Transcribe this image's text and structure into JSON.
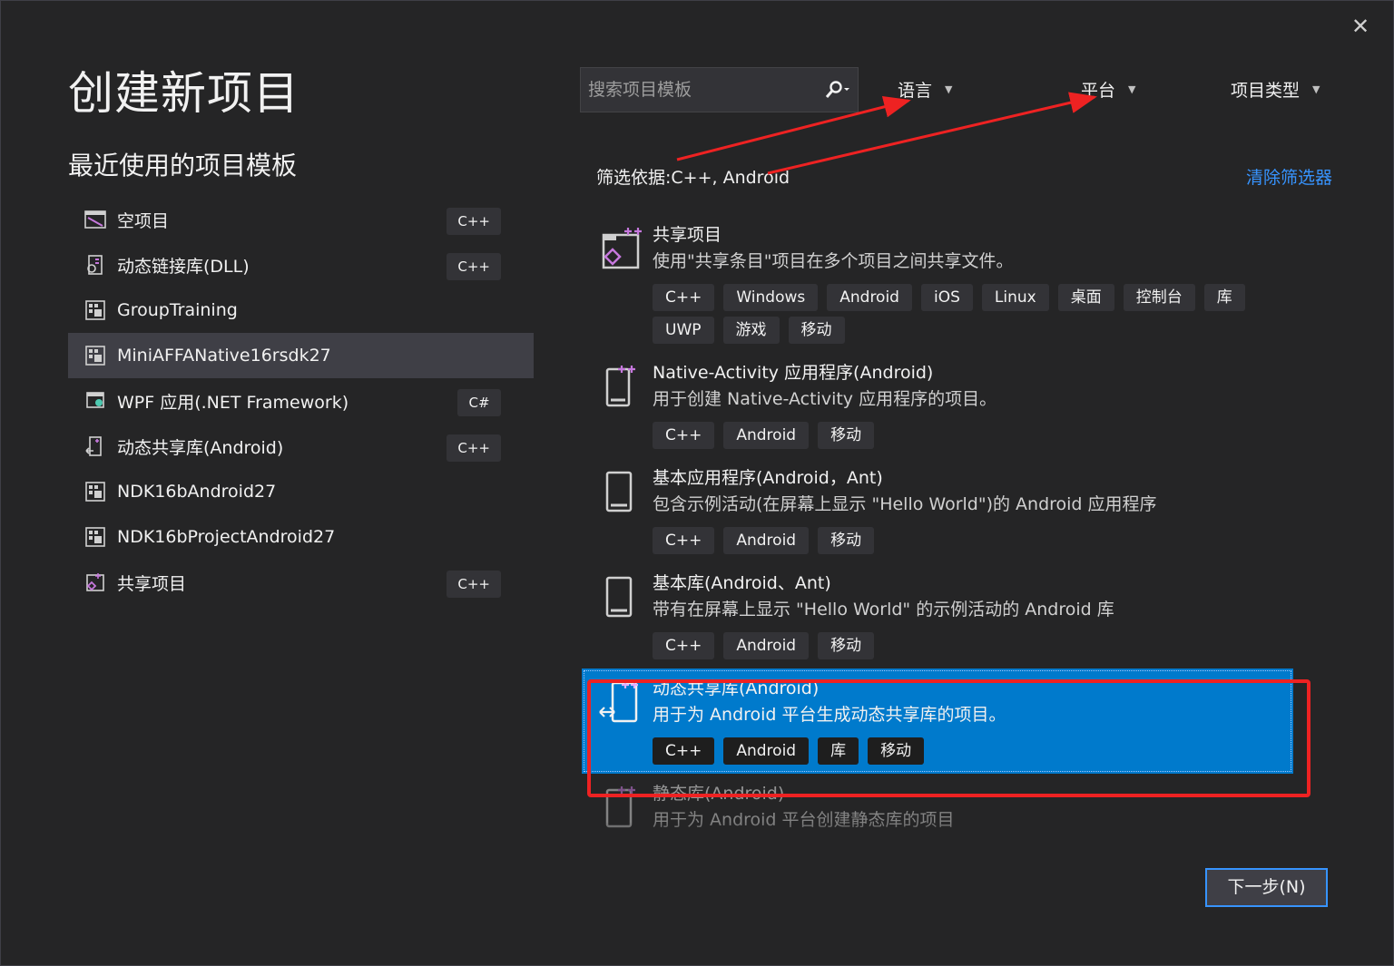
{
  "dialog": {
    "title": "创建新项目",
    "close_icon": "close-icon"
  },
  "recent": {
    "heading": "最近使用的项目模板",
    "items": [
      {
        "name": "空项目",
        "lang": "C++",
        "icon": "empty-project-icon"
      },
      {
        "name": "动态链接库(DLL)",
        "lang": "C++",
        "icon": "dll-icon"
      },
      {
        "name": "GroupTraining",
        "lang": "",
        "icon": "custom-template-icon"
      },
      {
        "name": "MiniAFFANative16rsdk27",
        "lang": "",
        "icon": "custom-template-icon",
        "selected": true
      },
      {
        "name": "WPF 应用(.NET Framework)",
        "lang": "C#",
        "icon": "wpf-icon"
      },
      {
        "name": "动态共享库(Android)",
        "lang": "C++",
        "icon": "android-lib-icon"
      },
      {
        "name": "NDK16bAndroid27",
        "lang": "",
        "icon": "custom-template-icon"
      },
      {
        "name": "NDK16bProjectAndroid27",
        "lang": "",
        "icon": "custom-template-icon"
      },
      {
        "name": "共享项目",
        "lang": "C++",
        "icon": "shared-project-icon"
      }
    ]
  },
  "search": {
    "placeholder": "搜索项目模板",
    "icon": "search-icon"
  },
  "filters": {
    "language": "语言",
    "platform": "平台",
    "project_type": "项目类型",
    "filter_by": "筛选依据:C++, Android",
    "clear": "清除筛选器"
  },
  "templates": [
    {
      "name": "共享项目",
      "desc": "使用\"共享条目\"项目在多个项目之间共享文件。",
      "icon": "shared-project-icon",
      "tags": [
        "C++",
        "Windows",
        "Android",
        "iOS",
        "Linux",
        "桌面",
        "控制台",
        "库",
        "UWP",
        "游戏",
        "移动"
      ]
    },
    {
      "name": "Native-Activity 应用程序(Android)",
      "desc": "用于创建 Native-Activity 应用程序的项目。",
      "icon": "native-activity-icon",
      "tags": [
        "C++",
        "Android",
        "移动"
      ]
    },
    {
      "name": "基本应用程序(Android，Ant)",
      "desc": "包含示例活动(在屏幕上显示 \"Hello World\")的 Android 应用程序",
      "icon": "phone-icon",
      "tags": [
        "C++",
        "Android",
        "移动"
      ]
    },
    {
      "name": "基本库(Android、Ant)",
      "desc": "带有在屏幕上显示 \"Hello World\" 的示例活动的 Android 库",
      "icon": "phone-icon",
      "tags": [
        "C++",
        "Android",
        "移动"
      ]
    },
    {
      "name": "动态共享库(Android)",
      "desc": "用于为 Android 平台生成动态共享库的项目。",
      "icon": "android-lib-icon",
      "tags": [
        "C++",
        "Android",
        "库",
        "移动"
      ],
      "selected": true
    },
    {
      "name": "静态库(Android)",
      "desc": "用于为 Android 平台创建静态库的项目",
      "icon": "static-lib-icon",
      "tags": []
    }
  ],
  "next_button": "下一步(N)",
  "colors": {
    "background": "#252526",
    "accent": "#007acc",
    "link": "#3794ff",
    "annotation": "#ee2222"
  }
}
